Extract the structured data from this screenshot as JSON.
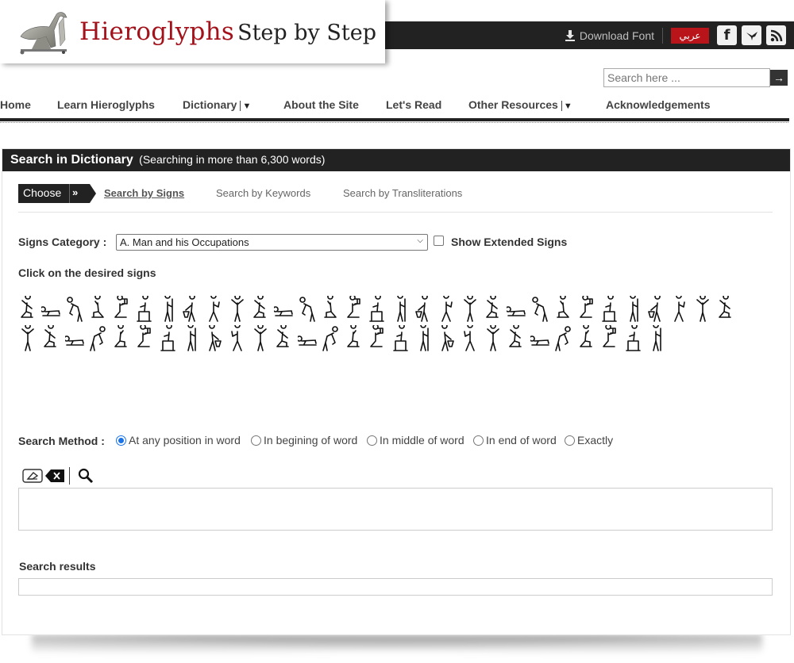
{
  "header": {
    "logo_title_red": "Hieroglyphs",
    "logo_title_black": "Step by Step",
    "download_font_label": "Download Font",
    "arabic_label": "عربي",
    "social": [
      "facebook",
      "twitter",
      "rss"
    ],
    "search_placeholder": "Search here ...",
    "search_button": "→"
  },
  "nav": {
    "items": [
      {
        "label": "Home",
        "dropdown": false
      },
      {
        "label": "Learn Hieroglyphs",
        "dropdown": false
      },
      {
        "label": "Dictionary",
        "dropdown": true
      },
      {
        "label": "About the Site",
        "dropdown": false
      },
      {
        "label": "Let's Read",
        "dropdown": false
      },
      {
        "label": "Other Resources",
        "dropdown": true
      },
      {
        "label": "Acknowledgements",
        "dropdown": false
      }
    ],
    "caret": "▼"
  },
  "panel": {
    "title": "Search in Dictionary",
    "subtitle": "(Searching in more than 6,300 words)",
    "choose_label": "Choose",
    "choose_chevron": "»",
    "tabs": [
      {
        "label": "Search by Signs",
        "active": true
      },
      {
        "label": "Search by Keywords",
        "active": false
      },
      {
        "label": "Search by Transliterations",
        "active": false
      }
    ],
    "signs_category_label": "Signs Category :",
    "signs_category_value": "A. Man and his Occupations",
    "show_extended_label": "Show Extended Signs",
    "show_extended_checked": false,
    "click_signs_label": "Click on the desired signs",
    "signs_row1_count": 31,
    "signs_row2_count": 28,
    "search_method_label": "Search Method :",
    "search_methods": [
      {
        "label": "At any position in word",
        "checked": true
      },
      {
        "label": "In begining of word",
        "checked": false
      },
      {
        "label": "In middle of word",
        "checked": false
      },
      {
        "label": "In end of word",
        "checked": false
      },
      {
        "label": "Exactly",
        "checked": false
      }
    ],
    "tools": [
      "eraser",
      "backspace",
      "search"
    ],
    "input_value": "",
    "results_label": "Search results",
    "results_value": ""
  },
  "colors": {
    "brand_red": "#a3121b",
    "dark_bar": "#222222",
    "arabic_button": "#b8141a"
  }
}
